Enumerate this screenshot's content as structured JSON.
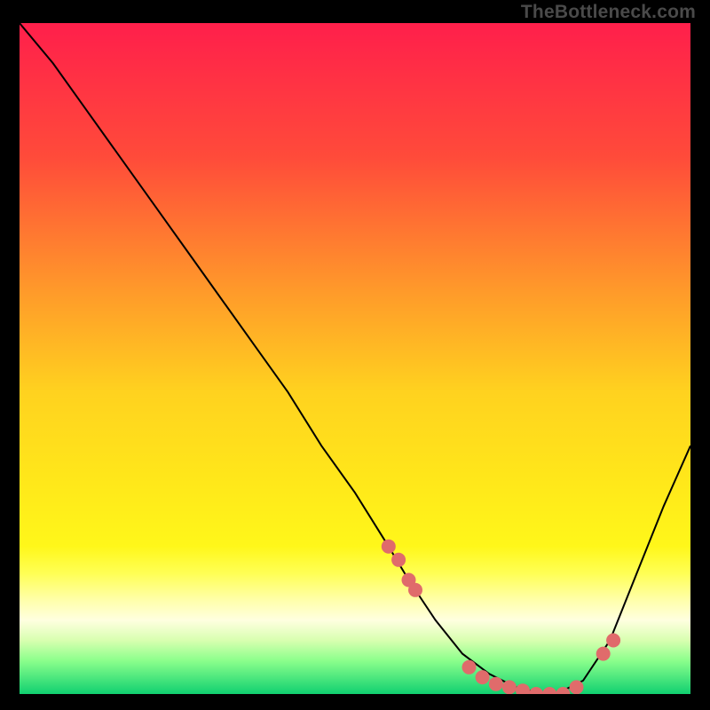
{
  "watermark": "TheBottleneck.com",
  "chart_data": {
    "type": "line",
    "title": "",
    "xlabel": "",
    "ylabel": "",
    "xlim": [
      0,
      100
    ],
    "ylim": [
      0,
      100
    ],
    "grid": false,
    "legend": false,
    "background_gradient_stops": [
      {
        "pos": 0.0,
        "color": "#ff1f4b"
      },
      {
        "pos": 0.2,
        "color": "#ff4b3a"
      },
      {
        "pos": 0.4,
        "color": "#ff9a2a"
      },
      {
        "pos": 0.55,
        "color": "#ffd21f"
      },
      {
        "pos": 0.68,
        "color": "#ffe71a"
      },
      {
        "pos": 0.78,
        "color": "#fff71a"
      },
      {
        "pos": 0.82,
        "color": "#ffff55"
      },
      {
        "pos": 0.86,
        "color": "#ffffaa"
      },
      {
        "pos": 0.89,
        "color": "#ffffe0"
      },
      {
        "pos": 0.92,
        "color": "#d8ffb0"
      },
      {
        "pos": 0.95,
        "color": "#8cff8c"
      },
      {
        "pos": 1.0,
        "color": "#10d070"
      }
    ],
    "series": [
      {
        "name": "bottleneck-curve",
        "color": "#000000",
        "x": [
          0,
          5,
          10,
          15,
          20,
          25,
          30,
          35,
          40,
          45,
          50,
          55,
          58,
          62,
          66,
          70,
          74,
          78,
          80,
          84,
          88,
          92,
          96,
          100
        ],
        "y": [
          100,
          94,
          87,
          80,
          73,
          66,
          59,
          52,
          45,
          37,
          30,
          22,
          17,
          11,
          6,
          3,
          1,
          0,
          0,
          2,
          8,
          18,
          28,
          37
        ]
      }
    ],
    "markers": {
      "name": "highlight-points",
      "color": "#e06b6b",
      "radius": 8,
      "x": [
        55,
        56.5,
        58,
        59,
        67,
        69,
        71,
        73,
        75,
        77,
        79,
        81,
        83,
        87,
        88.5
      ],
      "y": [
        22,
        20,
        17,
        15.5,
        4,
        2.5,
        1.5,
        1,
        0.5,
        0,
        0,
        0,
        1,
        6,
        8
      ]
    }
  }
}
